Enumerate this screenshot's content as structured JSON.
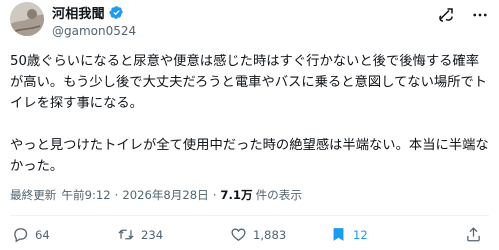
{
  "author": {
    "display_name": "河相我聞",
    "handle": "@gamon0524"
  },
  "tweet": {
    "paragraph_1": "50歳ぐらいになると尿意や便意は感じた時はすぐ行かないと後で後悔する確率が高い。もう少し後で大丈夫だろうと電車やバスに乗ると意図してない場所でトイレを探す事になる。",
    "paragraph_2": "やっと見つけたトイレが全て使用中だった時の絶望感は半端ない。本当に半端なかった。"
  },
  "meta": {
    "updated_label": "最終更新",
    "time": "午前9:12",
    "separator": "·",
    "date": "2026年8月28日",
    "views_count": "7.1万",
    "views_label": "件の表示"
  },
  "actions": {
    "replies": "64",
    "reposts": "234",
    "likes": "1,883",
    "bookmarks": "12"
  },
  "icons": {
    "verified": "verified-badge-icon",
    "grok": "grok-icon",
    "more": "more-icon",
    "reply": "reply-icon",
    "repost": "repost-icon",
    "like": "like-icon",
    "bookmark": "bookmark-icon",
    "share": "share-icon"
  },
  "colors": {
    "verified_blue": "#1d9bf0",
    "text_primary": "#0f1419",
    "text_secondary": "#536471"
  }
}
